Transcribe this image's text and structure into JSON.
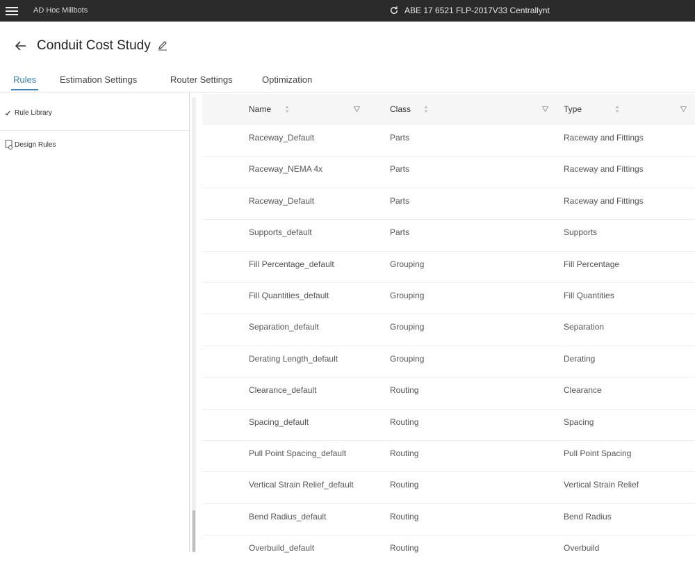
{
  "topbar": {
    "app_name": "AD Hoc Millbots",
    "center_status": "ABE 17 6521 FLP-2017V33 Centrallynt"
  },
  "header": {
    "title": "Conduit Cost Study"
  },
  "tabs": [
    {
      "label": "Rules",
      "active": true
    },
    {
      "label": "Estimation Settings",
      "active": false
    },
    {
      "label": "Router Settings",
      "active": false
    },
    {
      "label": "Optimization",
      "active": false
    }
  ],
  "sidebar": {
    "rule_library": "Rule Library",
    "design_rules": "Design Rules"
  },
  "table": {
    "columns": [
      "Name",
      "Class",
      "Type"
    ],
    "rows": [
      {
        "name": "Raceway_Default",
        "class": "Parts",
        "type": "Raceway and Fittings"
      },
      {
        "name": "Raceway_NEMA 4x",
        "class": "Parts",
        "type": "Raceway and Fittings"
      },
      {
        "name": "Raceway_Default",
        "class": "Parts",
        "type": "Raceway and Fittings"
      },
      {
        "name": "Supports_default",
        "class": "Parts",
        "type": "Supports"
      },
      {
        "name": "Fill Percentage_default",
        "class": "Grouping",
        "type": "Fill Percentage"
      },
      {
        "name": "Fill Quantities_default",
        "class": "Grouping",
        "type": "Fill Quantities"
      },
      {
        "name": "Separation_default",
        "class": "Grouping",
        "type": "Separation"
      },
      {
        "name": "Derating Length_default",
        "class": "Grouping",
        "type": "Derating"
      },
      {
        "name": "Clearance_default",
        "class": "Routing",
        "type": "Clearance"
      },
      {
        "name": "Spacing_default",
        "class": "Routing",
        "type": "Spacing"
      },
      {
        "name": "Pull Point Spacing_default",
        "class": "Routing",
        "type": "Pull Point Spacing"
      },
      {
        "name": "Vertical Strain Relief_default",
        "class": "Routing",
        "type": "Vertical Strain Relief"
      },
      {
        "name": "Bend Radius_default",
        "class": "Routing",
        "type": "Bend Radius"
      },
      {
        "name": "Overbuild_default",
        "class": "Routing",
        "type": "Overbuild"
      }
    ]
  },
  "colors": {
    "topbar_bg": "#2b2b2b",
    "accent": "#3a86c8"
  },
  "icons": {
    "menu": "hamburger-menu-icon",
    "sync": "sync-icon",
    "back": "arrow-left-icon",
    "edit": "pencil-icon",
    "check": "checkmark-icon",
    "rules": "rule-document-icon",
    "sort": "sort-icon",
    "filter": "filter-icon"
  }
}
